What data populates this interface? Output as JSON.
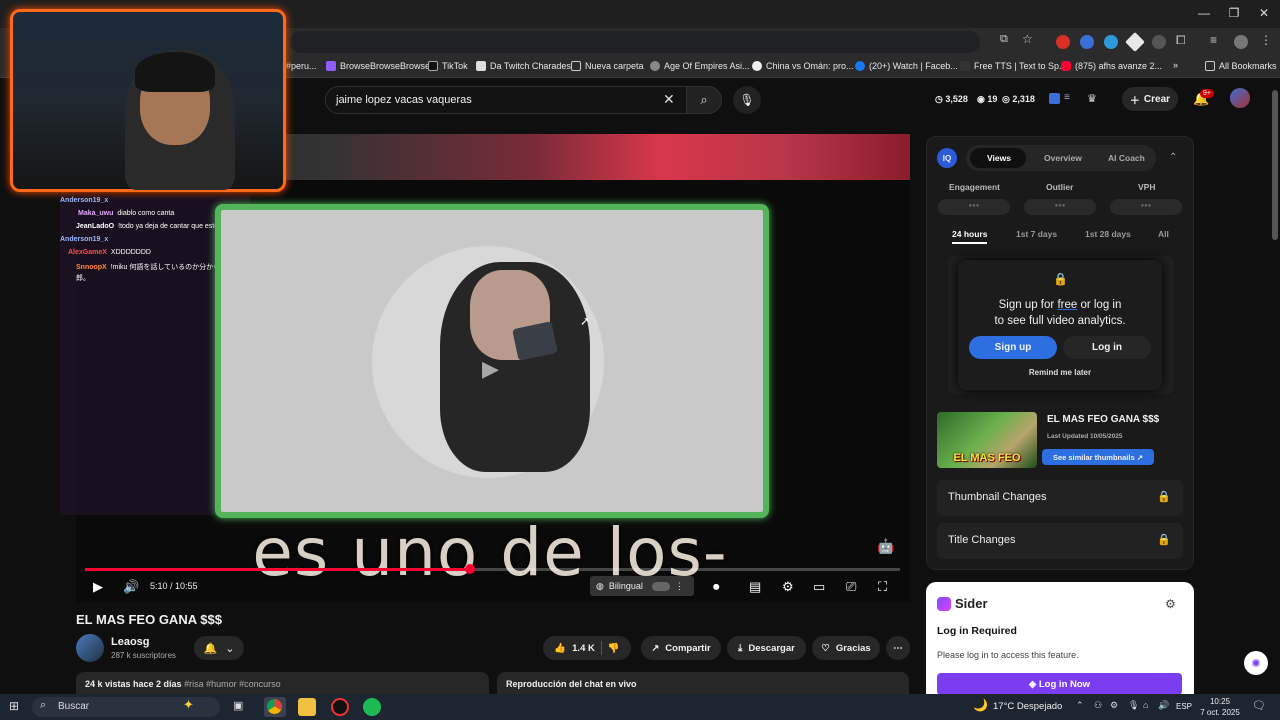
{
  "browser": {
    "bookmarks": [
      "#peru...",
      "BrowseBrowseBrowse",
      "TikTok",
      "Da Twitch Charades",
      "Nueva carpeta",
      "Age Of Empires Asi...",
      "China vs Omán: pro...",
      "(20+) Watch | Faceb...",
      "Free TTS | Text to Sp...",
      "(875) afhs avanze 2..."
    ],
    "all_bookmarks": "All Bookmarks",
    "more": "»"
  },
  "header": {
    "search_value": "jaime lopez vacas vaqueras",
    "stats": [
      "3,528",
      "19",
      "2,318"
    ],
    "create_label": "Crear",
    "notif_count": "9+"
  },
  "chat": [
    {
      "user": "Anderson19_x",
      "msg": "",
      "user_color": "#9ab8ff"
    },
    {
      "user": "Maka_uwu",
      "msg": "diablo como canta",
      "user_color": "#e4a8ff"
    },
    {
      "user": "JeanLadoO",
      "msg": "!todo ya deja de cantar que estoy en el baño",
      "user_color": "#ffffff"
    },
    {
      "user": "Anderson19_x",
      "msg": "",
      "user_color": "#9ab8ff"
    },
    {
      "user": "AlexGameX",
      "msg": "XDDDDDDD",
      "user_color": "#ff4d4d"
    },
    {
      "user": "SnnoopX",
      "msg": "!miku 何語を話しているのか分からないんだ、この野郎。",
      "user_color": "#ff8a3d"
    }
  ],
  "player": {
    "subtitle": "es uno de los-",
    "time": "5:10 / 10:55",
    "progress": 0.473,
    "bilingual": "Bilingual"
  },
  "video": {
    "title": "EL MAS FEO GANA $$$",
    "channel": "Leaosg",
    "subs": "287 k suscriptores",
    "likes": "1.4 K",
    "share": "Compartir",
    "download": "Descargar",
    "thanks": "Gracias",
    "desc_stats": "24 k vistas  hace 2 días",
    "desc_tags": "#risa #humor #concurso",
    "chat_replay": "Reproducción del chat en vivo"
  },
  "analytics": {
    "logo": "IQ",
    "tabs": [
      "Views",
      "Overview",
      "AI Coach"
    ],
    "metrics": [
      "Engagement",
      "Outlier",
      "VPH"
    ],
    "metric_placeholder": "●●●",
    "periods": [
      "24 hours",
      "1st 7 days",
      "1st 28 days",
      "All"
    ],
    "signup_line1_a": "Sign up for ",
    "signup_free": "free",
    "signup_line1_b": " or log in",
    "signup_line2": "to see full video analytics.",
    "signup_btn": "Sign up",
    "login_btn": "Log in",
    "remind": "Remind me later",
    "thumb_title": "EL MAS FEO GANA $$$",
    "thumb_updated": "Last Updated 10/05/2025",
    "thumb_text": "EL MAS FEO",
    "similar_btn": "See similar thumbnails",
    "features": [
      "Thumbnail Changes",
      "Title Changes"
    ]
  },
  "sider": {
    "name": "Sider",
    "required": "Log in Required",
    "msg": "Please log in to access this feature.",
    "btn": "Log in Now"
  },
  "taskbar": {
    "search": "Buscar",
    "weather": "17°C  Despejado",
    "lang": "ESP",
    "time": "10:25",
    "date": "7 oct. 2025"
  },
  "colors": {
    "accent_red": "#ff0033",
    "frame_green": "#53b45a",
    "webcam_orange": "#ff6a1a",
    "analytics_blue": "#2d6fe0",
    "sider_purple": "#7b3df2"
  }
}
